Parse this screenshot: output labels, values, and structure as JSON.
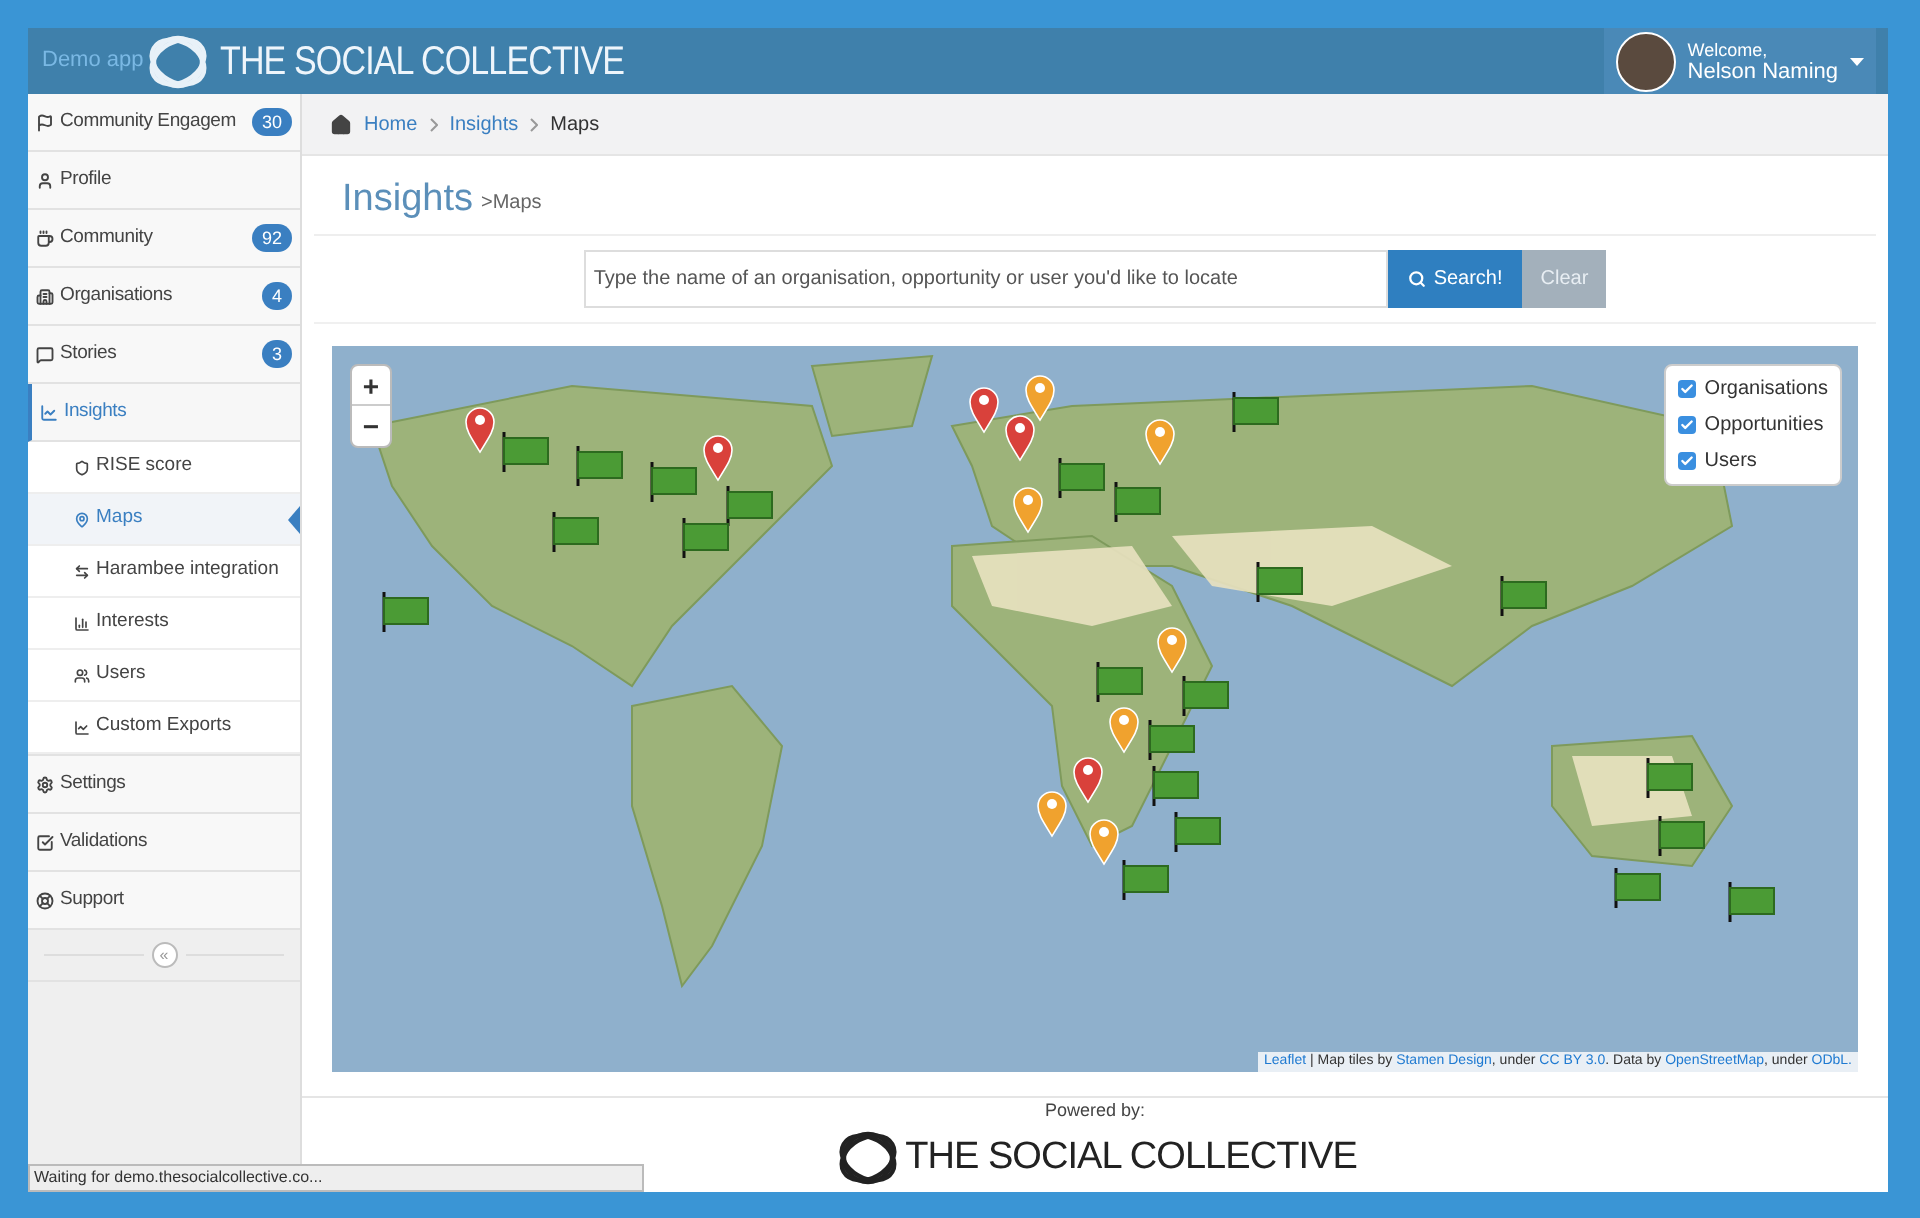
{
  "header": {
    "demo_label": "Demo app",
    "logo_text": "THE SOCIAL COLLECTIVE",
    "welcome": "Welcome,",
    "user_name": "Nelson Naming"
  },
  "sidebar": {
    "items": [
      {
        "label": "Community Engagem",
        "badge": "30",
        "selected": false
      },
      {
        "label": "Profile",
        "selected": false
      },
      {
        "label": "Community",
        "badge": "92",
        "selected": false
      },
      {
        "label": "Organisations",
        "badge": "4",
        "selected": false
      },
      {
        "label": "Stories",
        "badge": "3",
        "selected": false
      },
      {
        "label": "Insights",
        "selected": true,
        "expanded": true,
        "children": [
          {
            "label": "RISE score",
            "selected": false
          },
          {
            "label": "Maps",
            "selected": true
          },
          {
            "label": "Harambee integration",
            "selected": false
          },
          {
            "label": "Interests",
            "selected": false
          },
          {
            "label": "Users",
            "selected": false
          },
          {
            "label": "Custom Exports",
            "selected": false
          }
        ]
      },
      {
        "label": "Settings",
        "selected": false
      },
      {
        "label": "Validations",
        "selected": false
      },
      {
        "label": "Support",
        "selected": false
      }
    ],
    "collapse": "«"
  },
  "breadcrumb": [
    {
      "label": "Home",
      "link": true
    },
    {
      "label": "Insights",
      "link": true
    },
    {
      "label": "Maps",
      "link": false
    }
  ],
  "page_title": "Insights",
  "page_subtitle": ">Maps",
  "search": {
    "placeholder": "Type the name of an organisation, opportunity or user you'd like to locate",
    "button": "Search!",
    "clear": "Clear"
  },
  "map": {
    "zoom_in": "+",
    "zoom_out": "−",
    "layers": [
      {
        "label": "Organisations",
        "checked": true
      },
      {
        "label": "Opportunities",
        "checked": true
      },
      {
        "label": "Users",
        "checked": true
      }
    ],
    "attribution": [
      {
        "text": "Leaflet",
        "kind": "link"
      },
      {
        "text": " | Map tiles by ",
        "kind": "text"
      },
      {
        "text": "Stamen Design",
        "kind": "link"
      },
      {
        "text": ", under ",
        "kind": "text"
      },
      {
        "text": "CC BY 3.0",
        "kind": "link"
      },
      {
        "text": ". Data by ",
        "kind": "text"
      },
      {
        "text": "OpenStreetMap",
        "kind": "link"
      },
      {
        "text": ", under ",
        "kind": "text"
      },
      {
        "text": "ODbL.",
        "kind": "link"
      }
    ]
  },
  "footer": {
    "powered_by": "Powered by:",
    "logo_text": "THE SOCIAL COLLECTIVE"
  },
  "status_bar": "Waiting for demo.thesocialcollective.co..."
}
